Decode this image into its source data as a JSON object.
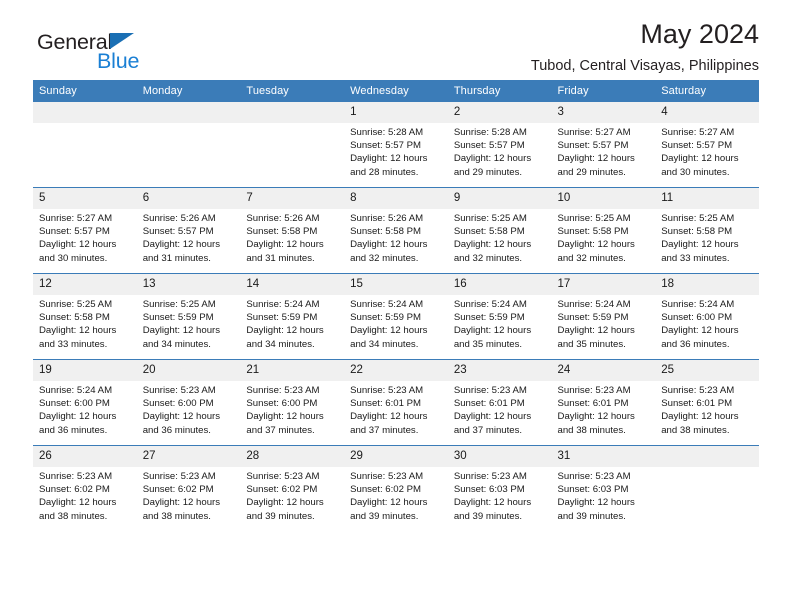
{
  "brand": {
    "name_part1": "General",
    "name_part2": "Blue",
    "triangle_color": "#1a6fb4",
    "blue_color": "#1a7fd4"
  },
  "header": {
    "month_title": "May 2024",
    "location": "Tubod, Central Visayas, Philippines",
    "header_bg": "#3b7cb8",
    "header_text_color": "#ffffff"
  },
  "weekday_headers": [
    "Sunday",
    "Monday",
    "Tuesday",
    "Wednesday",
    "Thursday",
    "Friday",
    "Saturday"
  ],
  "labels": {
    "sunrise_prefix": "Sunrise:",
    "sunset_prefix": "Sunset:",
    "daylight_prefix": "Daylight:"
  },
  "weeks": [
    [
      {
        "day": "",
        "empty": true
      },
      {
        "day": "",
        "empty": true
      },
      {
        "day": "",
        "empty": true
      },
      {
        "day": "1",
        "sunrise": "Sunrise: 5:28 AM",
        "sunset": "Sunset: 5:57 PM",
        "daylight": "Daylight: 12 hours and 28 minutes."
      },
      {
        "day": "2",
        "sunrise": "Sunrise: 5:28 AM",
        "sunset": "Sunset: 5:57 PM",
        "daylight": "Daylight: 12 hours and 29 minutes."
      },
      {
        "day": "3",
        "sunrise": "Sunrise: 5:27 AM",
        "sunset": "Sunset: 5:57 PM",
        "daylight": "Daylight: 12 hours and 29 minutes."
      },
      {
        "day": "4",
        "sunrise": "Sunrise: 5:27 AM",
        "sunset": "Sunset: 5:57 PM",
        "daylight": "Daylight: 12 hours and 30 minutes."
      }
    ],
    [
      {
        "day": "5",
        "sunrise": "Sunrise: 5:27 AM",
        "sunset": "Sunset: 5:57 PM",
        "daylight": "Daylight: 12 hours and 30 minutes."
      },
      {
        "day": "6",
        "sunrise": "Sunrise: 5:26 AM",
        "sunset": "Sunset: 5:57 PM",
        "daylight": "Daylight: 12 hours and 31 minutes."
      },
      {
        "day": "7",
        "sunrise": "Sunrise: 5:26 AM",
        "sunset": "Sunset: 5:58 PM",
        "daylight": "Daylight: 12 hours and 31 minutes."
      },
      {
        "day": "8",
        "sunrise": "Sunrise: 5:26 AM",
        "sunset": "Sunset: 5:58 PM",
        "daylight": "Daylight: 12 hours and 32 minutes."
      },
      {
        "day": "9",
        "sunrise": "Sunrise: 5:25 AM",
        "sunset": "Sunset: 5:58 PM",
        "daylight": "Daylight: 12 hours and 32 minutes."
      },
      {
        "day": "10",
        "sunrise": "Sunrise: 5:25 AM",
        "sunset": "Sunset: 5:58 PM",
        "daylight": "Daylight: 12 hours and 32 minutes."
      },
      {
        "day": "11",
        "sunrise": "Sunrise: 5:25 AM",
        "sunset": "Sunset: 5:58 PM",
        "daylight": "Daylight: 12 hours and 33 minutes."
      }
    ],
    [
      {
        "day": "12",
        "sunrise": "Sunrise: 5:25 AM",
        "sunset": "Sunset: 5:58 PM",
        "daylight": "Daylight: 12 hours and 33 minutes."
      },
      {
        "day": "13",
        "sunrise": "Sunrise: 5:25 AM",
        "sunset": "Sunset: 5:59 PM",
        "daylight": "Daylight: 12 hours and 34 minutes."
      },
      {
        "day": "14",
        "sunrise": "Sunrise: 5:24 AM",
        "sunset": "Sunset: 5:59 PM",
        "daylight": "Daylight: 12 hours and 34 minutes."
      },
      {
        "day": "15",
        "sunrise": "Sunrise: 5:24 AM",
        "sunset": "Sunset: 5:59 PM",
        "daylight": "Daylight: 12 hours and 34 minutes."
      },
      {
        "day": "16",
        "sunrise": "Sunrise: 5:24 AM",
        "sunset": "Sunset: 5:59 PM",
        "daylight": "Daylight: 12 hours and 35 minutes."
      },
      {
        "day": "17",
        "sunrise": "Sunrise: 5:24 AM",
        "sunset": "Sunset: 5:59 PM",
        "daylight": "Daylight: 12 hours and 35 minutes."
      },
      {
        "day": "18",
        "sunrise": "Sunrise: 5:24 AM",
        "sunset": "Sunset: 6:00 PM",
        "daylight": "Daylight: 12 hours and 36 minutes."
      }
    ],
    [
      {
        "day": "19",
        "sunrise": "Sunrise: 5:24 AM",
        "sunset": "Sunset: 6:00 PM",
        "daylight": "Daylight: 12 hours and 36 minutes."
      },
      {
        "day": "20",
        "sunrise": "Sunrise: 5:23 AM",
        "sunset": "Sunset: 6:00 PM",
        "daylight": "Daylight: 12 hours and 36 minutes."
      },
      {
        "day": "21",
        "sunrise": "Sunrise: 5:23 AM",
        "sunset": "Sunset: 6:00 PM",
        "daylight": "Daylight: 12 hours and 37 minutes."
      },
      {
        "day": "22",
        "sunrise": "Sunrise: 5:23 AM",
        "sunset": "Sunset: 6:01 PM",
        "daylight": "Daylight: 12 hours and 37 minutes."
      },
      {
        "day": "23",
        "sunrise": "Sunrise: 5:23 AM",
        "sunset": "Sunset: 6:01 PM",
        "daylight": "Daylight: 12 hours and 37 minutes."
      },
      {
        "day": "24",
        "sunrise": "Sunrise: 5:23 AM",
        "sunset": "Sunset: 6:01 PM",
        "daylight": "Daylight: 12 hours and 38 minutes."
      },
      {
        "day": "25",
        "sunrise": "Sunrise: 5:23 AM",
        "sunset": "Sunset: 6:01 PM",
        "daylight": "Daylight: 12 hours and 38 minutes."
      }
    ],
    [
      {
        "day": "26",
        "sunrise": "Sunrise: 5:23 AM",
        "sunset": "Sunset: 6:02 PM",
        "daylight": "Daylight: 12 hours and 38 minutes."
      },
      {
        "day": "27",
        "sunrise": "Sunrise: 5:23 AM",
        "sunset": "Sunset: 6:02 PM",
        "daylight": "Daylight: 12 hours and 38 minutes."
      },
      {
        "day": "28",
        "sunrise": "Sunrise: 5:23 AM",
        "sunset": "Sunset: 6:02 PM",
        "daylight": "Daylight: 12 hours and 39 minutes."
      },
      {
        "day": "29",
        "sunrise": "Sunrise: 5:23 AM",
        "sunset": "Sunset: 6:02 PM",
        "daylight": "Daylight: 12 hours and 39 minutes."
      },
      {
        "day": "30",
        "sunrise": "Sunrise: 5:23 AM",
        "sunset": "Sunset: 6:03 PM",
        "daylight": "Daylight: 12 hours and 39 minutes."
      },
      {
        "day": "31",
        "sunrise": "Sunrise: 5:23 AM",
        "sunset": "Sunset: 6:03 PM",
        "daylight": "Daylight: 12 hours and 39 minutes."
      },
      {
        "day": "",
        "empty": true
      }
    ]
  ]
}
